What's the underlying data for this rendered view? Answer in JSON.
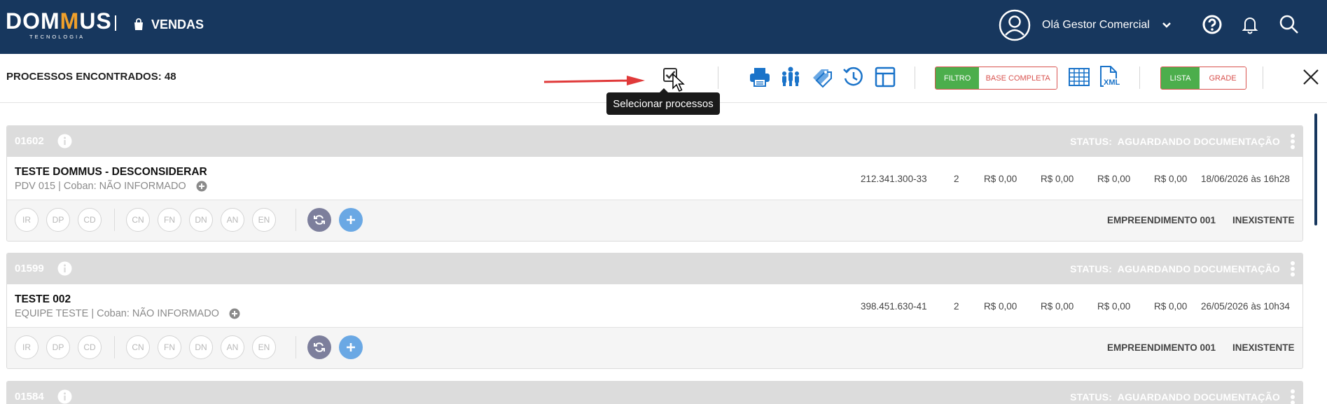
{
  "header": {
    "logo": "DOMMUS",
    "logo_sub": "TECNOLOGIA",
    "module": "VENDAS",
    "user_greeting": "Olá Gestor Comercial"
  },
  "toolbar": {
    "found_label": "PROCESSOS ENCONTRADOS: 48",
    "tooltip": "Selecionar processos",
    "filter_on": "FILTRO",
    "filter_off": "BASE COMPLETA",
    "view_on": "LISTA",
    "view_off": "GRADE",
    "xml_label": "XML"
  },
  "colors": {
    "header_bg": "#17375e",
    "accent_blue": "#1a73c9",
    "green": "#4cae4c",
    "red": "#d9534f",
    "orange": "#f0a02b"
  },
  "status_prefix": "STATUS:",
  "doc_pills": [
    "IR",
    "DP",
    "CD"
  ],
  "stage_pills": [
    "CN",
    "FN",
    "DN",
    "AN",
    "EN"
  ],
  "processes": [
    {
      "id": "01602",
      "status": "AGUARDANDO DOCUMENTAÇÃO",
      "title": "TESTE DOMMUS - DESCONSIDERAR",
      "subtitle": "PDV 015 | Coban: NÃO INFORMADO",
      "document": "212.341.300-33",
      "count": "2",
      "amounts": [
        "R$ 0,00",
        "R$ 0,00",
        "R$ 0,00",
        "R$ 0,00"
      ],
      "date": "18/06/2026 às 16h28",
      "project": "EMPREENDIMENTO 001",
      "unit": "INEXISTENTE"
    },
    {
      "id": "01599",
      "status": "AGUARDANDO DOCUMENTAÇÃO",
      "title": "TESTE 002",
      "subtitle": "EQUIPE TESTE | Coban: NÃO INFORMADO",
      "document": "398.451.630-41",
      "count": "2",
      "amounts": [
        "R$ 0,00",
        "R$ 0,00",
        "R$ 0,00",
        "R$ 0,00"
      ],
      "date": "26/05/2026 às 10h34",
      "project": "EMPREENDIMENTO 001",
      "unit": "INEXISTENTE"
    },
    {
      "id": "01584",
      "status": "AGUARDANDO DOCUMENTAÇÃO"
    }
  ]
}
